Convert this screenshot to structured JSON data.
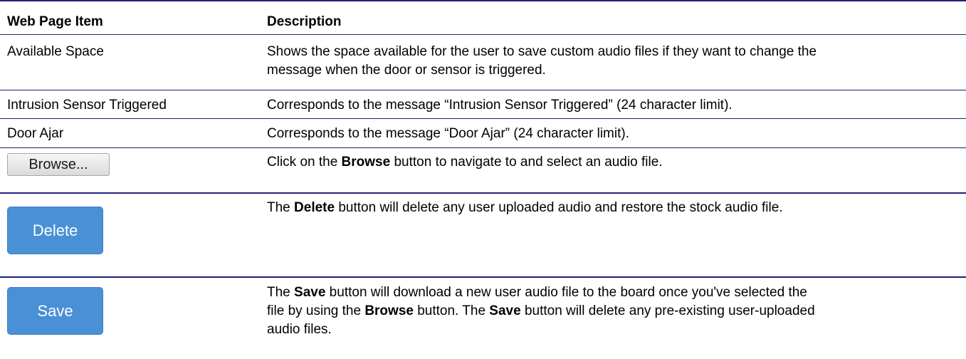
{
  "table": {
    "header": {
      "item": "Web Page Item",
      "description": "Description"
    },
    "rows": [
      {
        "item": "Available Space",
        "desc_line1": "Shows the space available for the user to save custom audio files if they want to change the",
        "desc_line2": "message when the door or sensor is triggered."
      },
      {
        "item": "Intrusion Sensor Triggered",
        "desc": "Corresponds to the message “Intrusion Sensor Triggered” (24 character limit)."
      },
      {
        "item": "Door Ajar",
        "desc": "Corresponds to the message “Door Ajar” (24 character limit)."
      },
      {
        "button_label": "Browse...",
        "desc_pre": "Click on the ",
        "desc_bold": "Browse",
        "desc_post": " button to navigate to and select an audio file."
      },
      {
        "button_label": "Delete",
        "desc_pre": "The ",
        "desc_bold": "Delete",
        "desc_post": " button will delete any user uploaded audio and restore the stock audio file."
      },
      {
        "button_label": "Save",
        "l1_pre": "The ",
        "l1_bold": "Save",
        "l1_post": " button will download a new user audio file to the board once you've selected the",
        "l2_pre": "file by using the ",
        "l2_bold1": "Browse",
        "l2_mid": " button. The ",
        "l2_bold2": "Save",
        "l2_post": " button will delete any pre-existing user-uploaded",
        "l3": "audio files."
      }
    ]
  },
  "colors": {
    "rule": "#1f1f7a",
    "button_blue": "#4a90d6",
    "browse_bg": "#e8e8e8"
  }
}
